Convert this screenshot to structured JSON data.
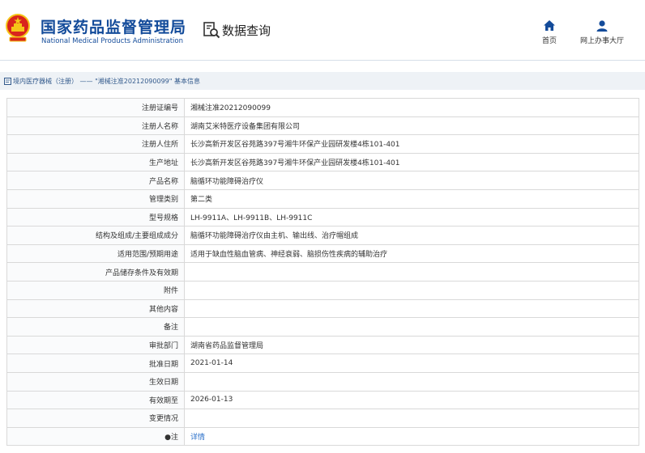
{
  "header": {
    "brand_cn": "国家药品监督管理局",
    "brand_en": "National Medical Products Administration",
    "query_label": "数据查询",
    "nav": [
      {
        "label": "首页",
        "icon": "home-icon"
      },
      {
        "label": "网上办事大厅",
        "icon": "user-icon"
      }
    ],
    "accent": "#134b9a",
    "emblem_colors": {
      "red": "#d9251d",
      "gold": "#f5c518"
    }
  },
  "breadcrumb": {
    "text": "境内医疗器械（注册） —— \"湘械注准20212090099\" 基本信息"
  },
  "table": {
    "rows": [
      {
        "key": "注册证编号",
        "value": "湘械注准20212090099"
      },
      {
        "key": "注册人名称",
        "value": "湖南艾米特医疗设备集团有限公司"
      },
      {
        "key": "注册人住所",
        "value": "长沙高新开发区谷苑路397号湘牛环保产业园研发楼4栋101-401"
      },
      {
        "key": "生产地址",
        "value": "长沙高新开发区谷苑路397号湘牛环保产业园研发楼4栋101-401"
      },
      {
        "key": "产品名称",
        "value": "脑循环功能障碍治疗仪"
      },
      {
        "key": "管理类别",
        "value": "第二类"
      },
      {
        "key": "型号规格",
        "value": "LH-9911A、LH-9911B、LH-9911C"
      },
      {
        "key": "结构及组成/主要组成成分",
        "value": "脑循环功能障碍治疗仪由主机、输出线、治疗帽组成"
      },
      {
        "key": "适用范围/预期用途",
        "value": "适用于缺血性脑血管病、神经衰弱、脑损伤性疾病的辅助治疗"
      },
      {
        "key": "产品储存条件及有效期",
        "value": ""
      },
      {
        "key": "附件",
        "value": ""
      },
      {
        "key": "其他内容",
        "value": ""
      },
      {
        "key": "备注",
        "value": ""
      },
      {
        "key": "审批部门",
        "value": "湖南省药品监督管理局"
      },
      {
        "key": "批准日期",
        "value": "2021-01-14"
      },
      {
        "key": "生效日期",
        "value": ""
      },
      {
        "key": "有效期至",
        "value": "2026-01-13"
      },
      {
        "key": "变更情况",
        "value": ""
      }
    ],
    "note_row": {
      "bullet": "●",
      "key": "注",
      "link": "详情"
    }
  }
}
